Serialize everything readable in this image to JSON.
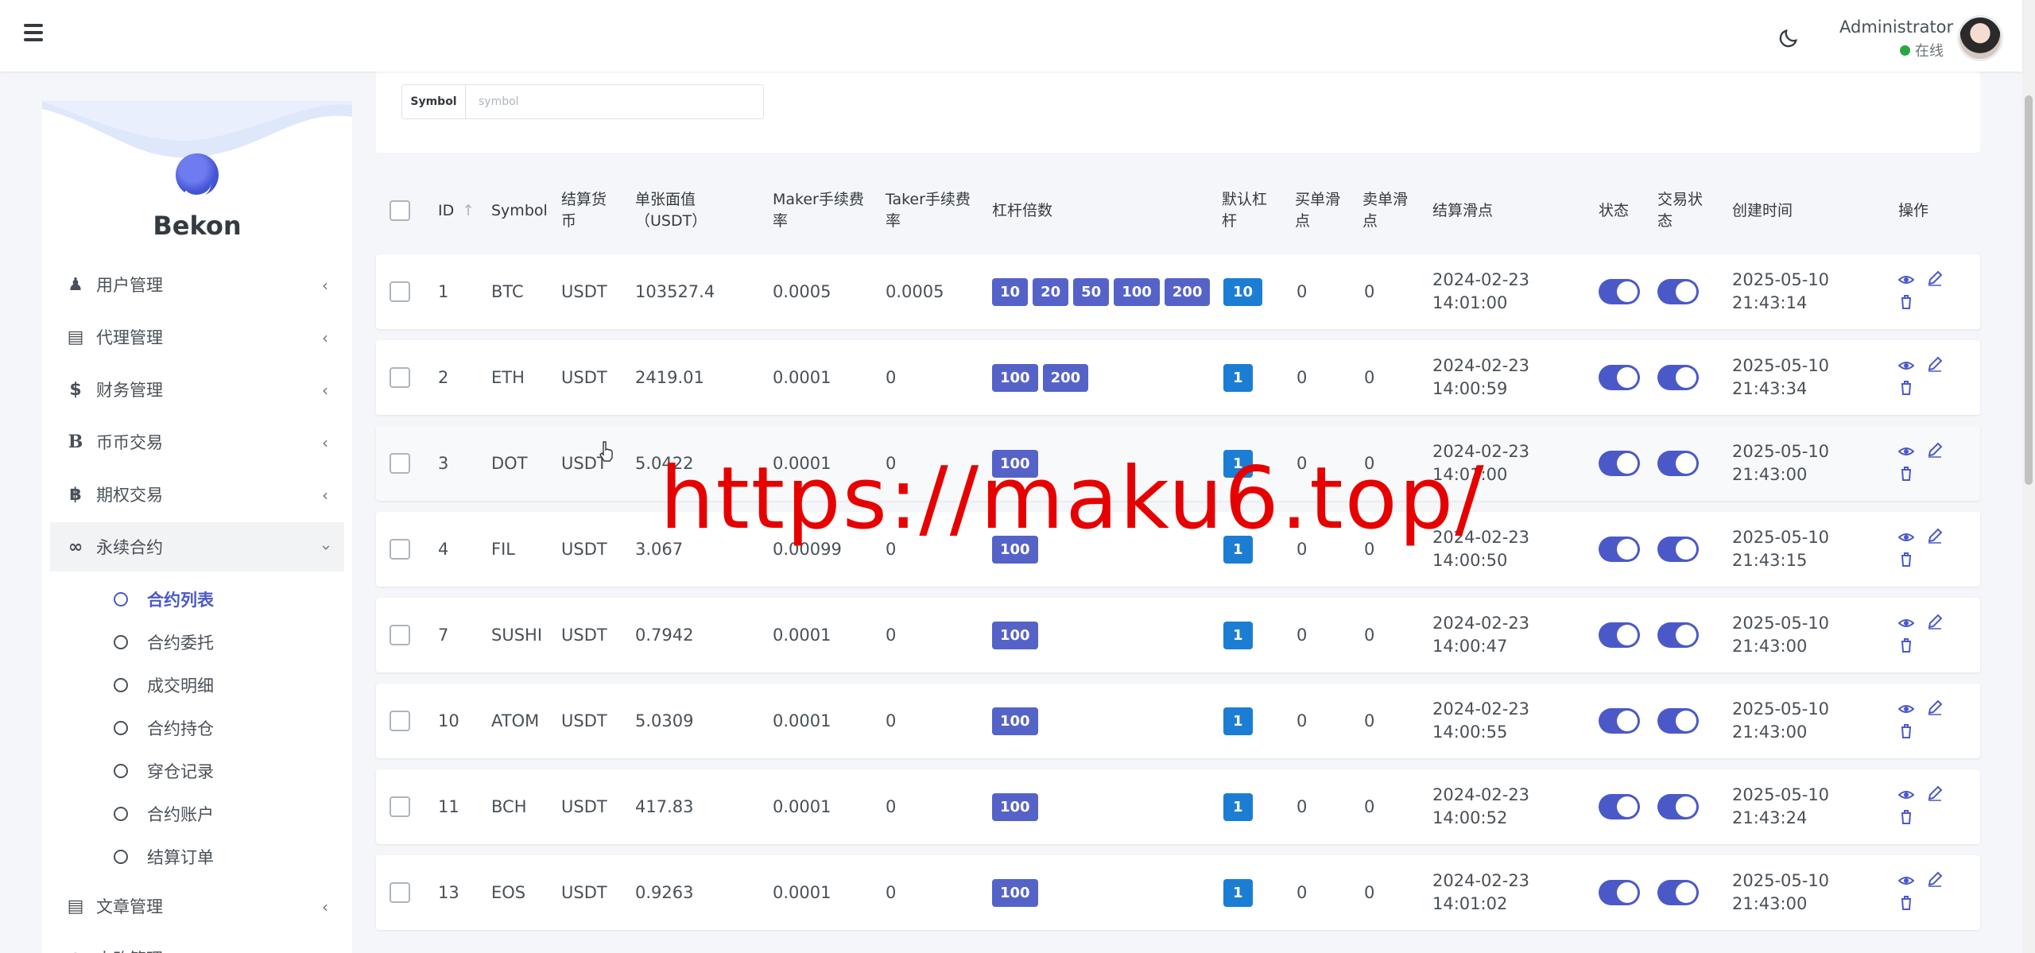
{
  "header": {
    "user_name": "Administrator",
    "user_status": "在线"
  },
  "sidebar": {
    "brand": "Bekon",
    "menu": [
      {
        "label": "用户管理",
        "icon": "user-tie-icon"
      },
      {
        "label": "代理管理",
        "icon": "id-card-icon"
      },
      {
        "label": "财务管理",
        "icon": "dollar-icon"
      },
      {
        "label": "币币交易",
        "icon": "bold-b-icon"
      },
      {
        "label": "期权交易",
        "icon": "bitcoin-icon"
      },
      {
        "label": "永续合约",
        "icon": "link-icon",
        "open": true
      }
    ],
    "submenu": [
      {
        "label": "合约列表",
        "active": true
      },
      {
        "label": "合约委托"
      },
      {
        "label": "成交明细"
      },
      {
        "label": "合约持仓"
      },
      {
        "label": "穿仓记录"
      },
      {
        "label": "合约账户"
      },
      {
        "label": "结算订单"
      }
    ],
    "menu_after": [
      {
        "label": "文章管理",
        "icon": "newspaper-icon"
      },
      {
        "label": "申购管理",
        "icon": "globe-icon"
      }
    ]
  },
  "filter": {
    "label": "Symbol",
    "placeholder": "symbol"
  },
  "table": {
    "headers": {
      "id": "ID",
      "symbol": "Symbol",
      "settle_currency": "结算货币",
      "face_value": "单张面值（USDT）",
      "maker_fee": "Maker手续费率",
      "taker_fee": "Taker手续费率",
      "leverage": "杠杆倍数",
      "default_leverage": "默认杠杆",
      "buy_slip": "买单滑点",
      "sell_slip": "卖单滑点",
      "settle_slip": "结算滑点",
      "status": "状态",
      "trade_status": "交易状态",
      "created": "创建时间",
      "actions": "操作"
    },
    "sort_icon": "arrow-up-icon",
    "rows": [
      {
        "id": "1",
        "symbol": "BTC",
        "currency": "USDT",
        "face": "103527.4",
        "maker": "0.0005",
        "taker": "0.0005",
        "leverage": [
          "10",
          "20",
          "50",
          "100",
          "200"
        ],
        "default": "10",
        "buy": "0",
        "sell": "0",
        "settle_date": "2024-02-23",
        "settle_time": "14:01:00",
        "created_date": "2025-05-10",
        "created_time": "21:43:14"
      },
      {
        "id": "2",
        "symbol": "ETH",
        "currency": "USDT",
        "face": "2419.01",
        "maker": "0.0001",
        "taker": "0",
        "leverage": [
          "100",
          "200"
        ],
        "default": "1",
        "buy": "0",
        "sell": "0",
        "settle_date": "2024-02-23",
        "settle_time": "14:00:59",
        "created_date": "2025-05-10",
        "created_time": "21:43:34"
      },
      {
        "id": "3",
        "symbol": "DOT",
        "currency": "USDT",
        "face": "5.0422",
        "maker": "0.0001",
        "taker": "0",
        "leverage": [
          "100"
        ],
        "default": "1",
        "buy": "0",
        "sell": "0",
        "settle_date": "2024-02-23",
        "settle_time": "14:01:00",
        "created_date": "2025-05-10",
        "created_time": "21:43:00"
      },
      {
        "id": "4",
        "symbol": "FIL",
        "currency": "USDT",
        "face": "3.067",
        "maker": "0.00099",
        "taker": "0",
        "leverage": [
          "100"
        ],
        "default": "1",
        "buy": "0",
        "sell": "0",
        "settle_date": "2024-02-23",
        "settle_time": "14:00:50",
        "created_date": "2025-05-10",
        "created_time": "21:43:15"
      },
      {
        "id": "7",
        "symbol": "SUSHI",
        "currency": "USDT",
        "face": "0.7942",
        "maker": "0.0001",
        "taker": "0",
        "leverage": [
          "100"
        ],
        "default": "1",
        "buy": "0",
        "sell": "0",
        "settle_date": "2024-02-23",
        "settle_time": "14:00:47",
        "created_date": "2025-05-10",
        "created_time": "21:43:00"
      },
      {
        "id": "10",
        "symbol": "ATOM",
        "currency": "USDT",
        "face": "5.0309",
        "maker": "0.0001",
        "taker": "0",
        "leverage": [
          "100"
        ],
        "default": "1",
        "buy": "0",
        "sell": "0",
        "settle_date": "2024-02-23",
        "settle_time": "14:00:55",
        "created_date": "2025-05-10",
        "created_time": "21:43:00"
      },
      {
        "id": "11",
        "symbol": "BCH",
        "currency": "USDT",
        "face": "417.83",
        "maker": "0.0001",
        "taker": "0",
        "leverage": [
          "100"
        ],
        "default": "1",
        "buy": "0",
        "sell": "0",
        "settle_date": "2024-02-23",
        "settle_time": "14:00:52",
        "created_date": "2025-05-10",
        "created_time": "21:43:24"
      },
      {
        "id": "13",
        "symbol": "EOS",
        "currency": "USDT",
        "face": "0.9263",
        "maker": "0.0001",
        "taker": "0",
        "leverage": [
          "100"
        ],
        "default": "1",
        "buy": "0",
        "sell": "0",
        "settle_date": "2024-02-23",
        "settle_time": "14:01:02",
        "created_date": "2025-05-10",
        "created_time": "21:43:00"
      }
    ]
  },
  "watermark": "https://maku6.top/",
  "colors": {
    "accent": "#4b59c8",
    "badge": "#5563c9",
    "default_badge": "#1b7ed4",
    "online": "#28a745",
    "watermark": "#e60000"
  }
}
